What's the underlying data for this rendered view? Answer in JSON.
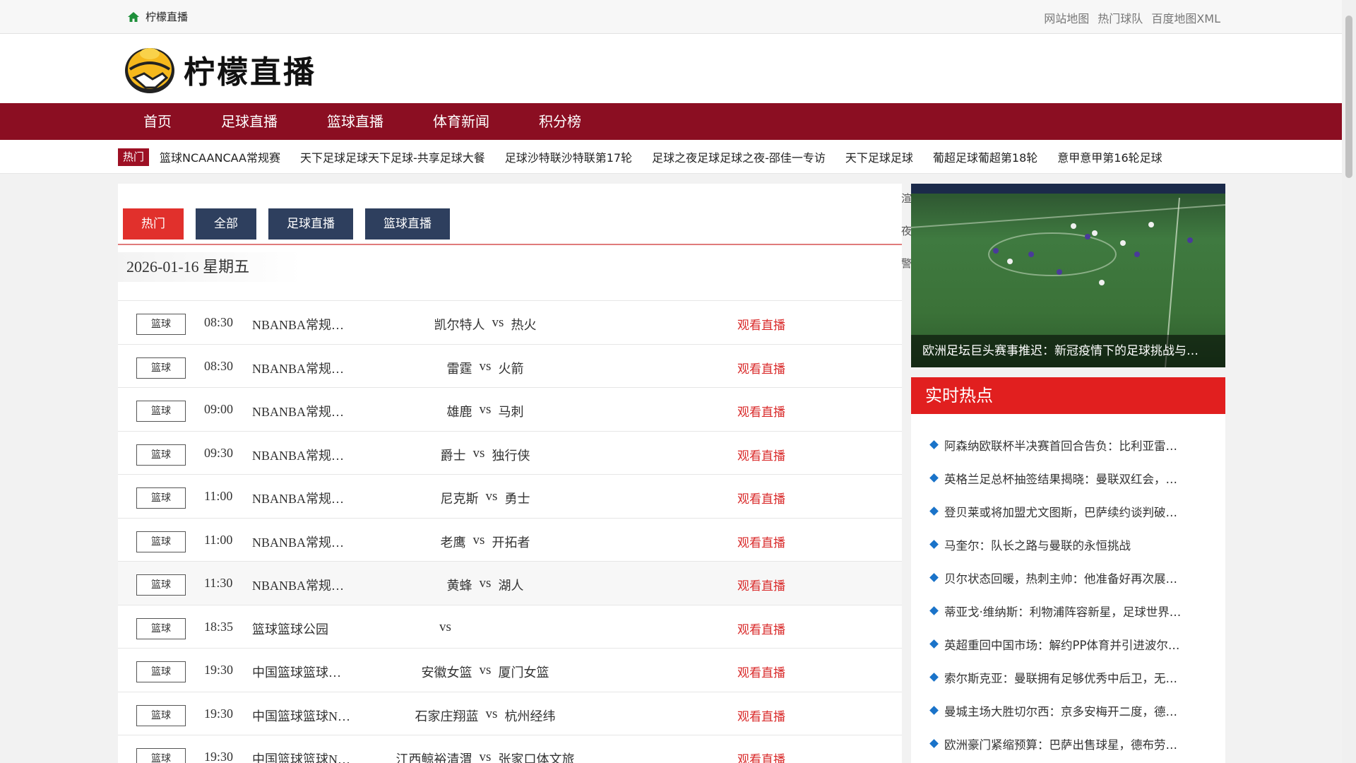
{
  "topbar": {
    "home_label": "柠檬直播",
    "links": [
      "网站地图",
      "热门球队",
      "百度地图XML"
    ]
  },
  "header": {
    "logo_text": "柠檬直播"
  },
  "nav": [
    "首页",
    "足球直播",
    "篮球直播",
    "体育新闻",
    "积分榜"
  ],
  "ticker": {
    "badge": "热门",
    "items": [
      "篮球NCAANCAA常规赛",
      "天下足球足球天下足球-共享足球大餐",
      "足球沙特联沙特联第17轮",
      "足球之夜足球足球之夜-邵佳一专访",
      "天下足球足球",
      "葡超足球葡超第18轮",
      "意甲意甲第16轮足球"
    ]
  },
  "main": {
    "tabs": [
      "热门",
      "全部",
      "足球直播",
      "篮球直播"
    ],
    "date": "2026-01-16 星期五",
    "watch_label": "观看直播",
    "matches": [
      {
        "tag": "篮球",
        "time": "08:30",
        "league": "NBANBA常规…",
        "home": "凯尔特人",
        "vs": "vs",
        "away": "热火"
      },
      {
        "tag": "篮球",
        "time": "08:30",
        "league": "NBANBA常规…",
        "home": "雷霆",
        "vs": "vs",
        "away": "火箭"
      },
      {
        "tag": "篮球",
        "time": "09:00",
        "league": "NBANBA常规…",
        "home": "雄鹿",
        "vs": "vs",
        "away": "马刺"
      },
      {
        "tag": "篮球",
        "time": "09:30",
        "league": "NBANBA常规…",
        "home": "爵士",
        "vs": "vs",
        "away": "独行侠"
      },
      {
        "tag": "篮球",
        "time": "11:00",
        "league": "NBANBA常规…",
        "home": "尼克斯",
        "vs": "vs",
        "away": "勇士"
      },
      {
        "tag": "篮球",
        "time": "11:00",
        "league": "NBANBA常规…",
        "home": "老鹰",
        "vs": "vs",
        "away": "开拓者"
      },
      {
        "tag": "篮球",
        "time": "11:30",
        "league": "NBANBA常规…",
        "home": "黄蜂",
        "vs": "vs",
        "away": "湖人"
      },
      {
        "tag": "篮球",
        "time": "18:35",
        "league": "篮球篮球公园",
        "home": "",
        "vs": "vs",
        "away": ""
      },
      {
        "tag": "篮球",
        "time": "19:30",
        "league": "中国篮球篮球…",
        "home": "安徽女篮",
        "vs": "vs",
        "away": "厦门女篮"
      },
      {
        "tag": "篮球",
        "time": "19:30",
        "league": "中国篮球篮球N…",
        "home": "石家庄翔蓝",
        "vs": "vs",
        "away": "杭州经纬"
      },
      {
        "tag": "篮球",
        "time": "19:30",
        "league": "中国篮球篮球N…",
        "home": "江西鲸裕清渭",
        "vs": "vs",
        "away": "张家口体文旅"
      }
    ]
  },
  "sidebar": {
    "stray_chars": [
      "渲",
      "夜",
      "警"
    ],
    "feature_caption": "欧洲足坛巨头赛事推迟：新冠疫情下的足球挑战与…",
    "hot_title": "实时热点",
    "hot_items": [
      "阿森纳欧联杯半决赛首回合告负：比利亚雷…",
      "英格兰足总杯抽签结果揭晓：曼联双红会，…",
      "登贝莱或将加盟尤文图斯，巴萨续约谈判破…",
      "马奎尔：队长之路与曼联的永恒挑战",
      "贝尔状态回暖，热刺主帅：他准备好再次展…",
      "蒂亚戈·维纳斯：利物浦阵容新星，足球世界…",
      "英超重回中国市场：解约PP体育并引进波尔…",
      "索尔斯克亚：曼联拥有足够优秀中后卫，无…",
      "曼城主场大胜切尔西：京多安梅开二度，德…",
      "欧洲豪门紧缩预算：巴萨出售球星，德布劳…"
    ]
  },
  "colors": {
    "nav_bg": "#8b0e22",
    "accent_red": "#e1302c",
    "tab_blue": "#2e3f5e",
    "watch_red": "#d92a2a",
    "bullet_blue": "#1a73c9"
  }
}
